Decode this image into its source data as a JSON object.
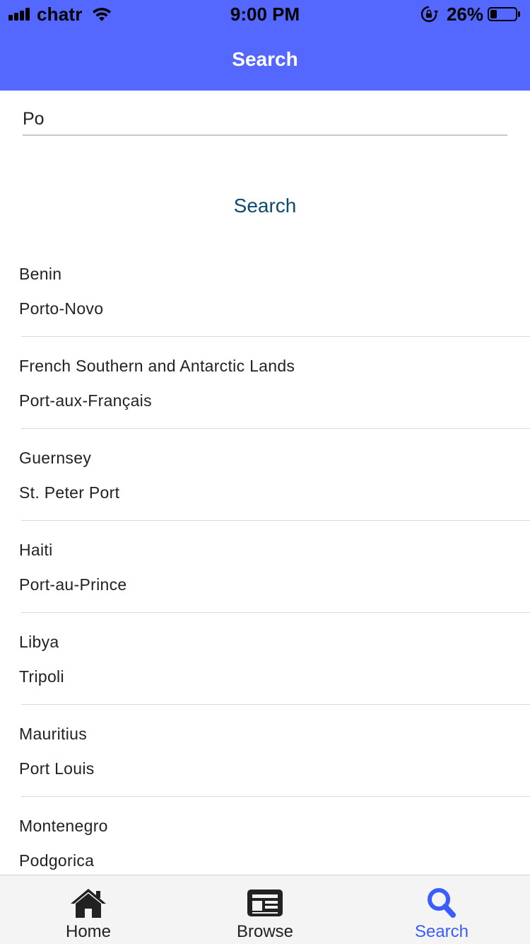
{
  "status_bar": {
    "carrier": "chatr",
    "time": "9:00 PM",
    "battery_percent": "26%",
    "battery_level": 0.26
  },
  "header": {
    "title": "Search"
  },
  "search": {
    "query": "Po",
    "button_label": "Search"
  },
  "results": [
    {
      "country": "Benin",
      "capital": "Porto-Novo"
    },
    {
      "country": "French Southern and Antarctic Lands",
      "capital": "Port-aux-Français"
    },
    {
      "country": "Guernsey",
      "capital": "St. Peter Port"
    },
    {
      "country": "Haiti",
      "capital": "Port-au-Prince"
    },
    {
      "country": "Libya",
      "capital": "Tripoli"
    },
    {
      "country": "Mauritius",
      "capital": "Port Louis"
    },
    {
      "country": "Montenegro",
      "capital": "Podgorica"
    }
  ],
  "tabs": [
    {
      "label": "Home",
      "icon": "home-icon",
      "active": false
    },
    {
      "label": "Browse",
      "icon": "newspaper-icon",
      "active": false
    },
    {
      "label": "Search",
      "icon": "search-icon",
      "active": true
    }
  ],
  "colors": {
    "header_bg": "#5468ff",
    "active_tab": "#3b5cff",
    "search_button_text": "#0b4b6f"
  }
}
